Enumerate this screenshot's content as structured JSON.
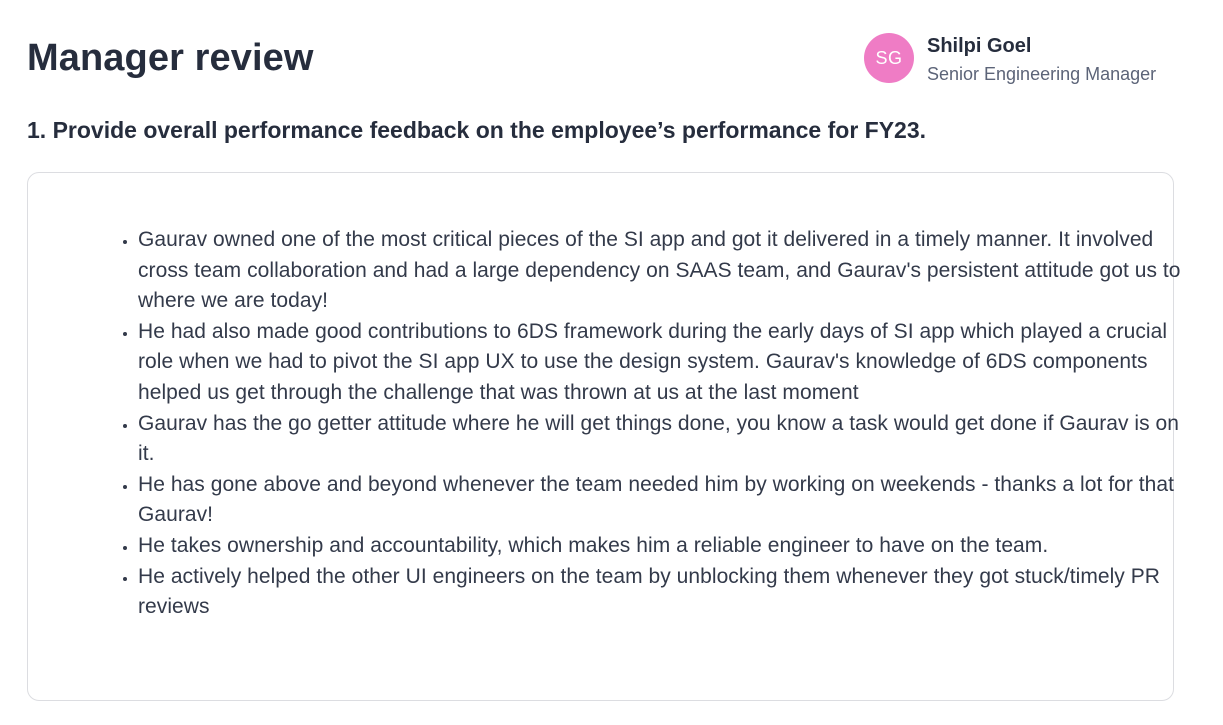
{
  "header": {
    "title": "Manager review"
  },
  "reviewer": {
    "initials": "SG",
    "name": "Shilpi Goel",
    "role": "Senior Engineering Manager",
    "avatar_color": "#ef7cc5"
  },
  "question": {
    "text": "1. Provide overall performance feedback on the employee’s performance for FY23."
  },
  "answer": {
    "items": [
      "Gaurav owned one of the most critical pieces of the SI app and got it delivered in a timely manner. It involved cross team collaboration and had a large dependency on SAAS team, and Gaurav's persistent attitude got us to where we are today!",
      "He had also made good contributions to 6DS framework during the early days of SI app which played a crucial role when we had to pivot the SI app UX to use the design system. Gaurav's knowledge of 6DS components helped us get through the challenge that was thrown at us at the last moment",
      "Gaurav has the go getter attitude where he will get things done, you know a task would get done if Gaurav is on it.",
      "He has gone above and beyond whenever the team needed him by working on weekends - thanks a lot for that Gaurav!",
      "He takes ownership and accountability, which makes him a reliable engineer to have on the team.",
      "He actively helped the other UI engineers on the team by unblocking them whenever they got stuck/timely PR reviews"
    ]
  }
}
